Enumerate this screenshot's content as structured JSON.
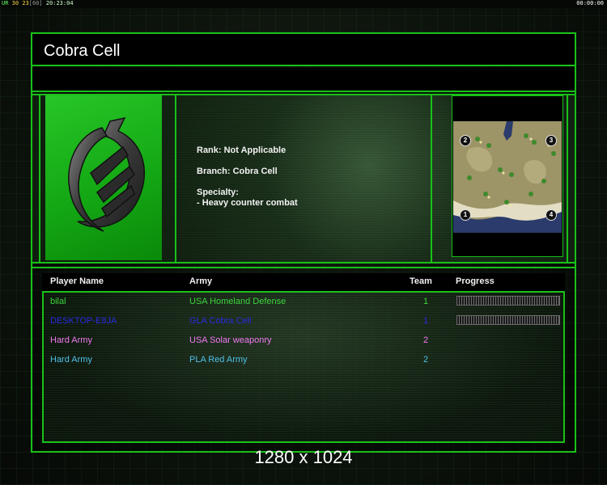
{
  "status_bar": {
    "fps_label": "UR",
    "fps_value_1": "30",
    "fps_value_2": "23",
    "fps_value_3": "[60]",
    "system_time": "20:23:04",
    "game_timer": "00:00:00"
  },
  "header": {
    "title": "Cobra Cell"
  },
  "info": {
    "rank": "Rank: Not Applicable",
    "branch": "Branch: Cobra Cell",
    "specialty_label": "Specialty:",
    "specialty_value": "- Heavy counter combat"
  },
  "minimap": {
    "start_positions": [
      "1",
      "2",
      "3",
      "4"
    ]
  },
  "players_table": {
    "columns": [
      "Player Name",
      "Army",
      "Team",
      "Progress"
    ],
    "rows": [
      {
        "name": "bilal",
        "army": "USA Homeland Defense",
        "team": "1",
        "progress": 1.0,
        "color": "#3dd43d"
      },
      {
        "name": "DESKTOP-E8JA",
        "army": "GLA Cobra Cell",
        "team": "1",
        "progress": 1.0,
        "color": "#2a2ae0"
      },
      {
        "name": "Hard Army",
        "army": "USA Solar weaponry",
        "team": "2",
        "color": "#f07af0"
      },
      {
        "name": "Hard Army",
        "army": "PLA Red Army",
        "team": "2",
        "color": "#4fc0e6"
      }
    ]
  },
  "footer": {
    "resolution": "1280 x 1024"
  },
  "colors": {
    "accent": "#19c119",
    "logo_bg": "#1cb41c"
  }
}
